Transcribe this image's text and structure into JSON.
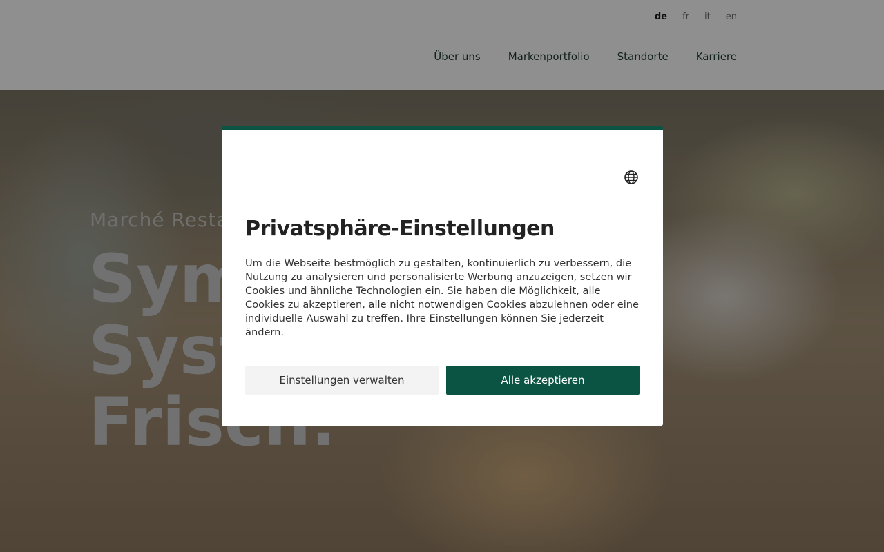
{
  "header": {
    "languages": [
      {
        "label": "de",
        "active": true
      },
      {
        "label": "fr",
        "active": false
      },
      {
        "label": "it",
        "active": false
      },
      {
        "label": "en",
        "active": false
      }
    ],
    "nav": [
      "Über uns",
      "Markenportfolio",
      "Standorte",
      "Karriere"
    ]
  },
  "hero": {
    "subtitle": "Marché Resta",
    "title_lines": [
      "Sym",
      "Syst",
      "Frisch."
    ]
  },
  "modal": {
    "language_icon": "globe-icon",
    "title": "Privatsphäre-Einstellungen",
    "text": "Um die Webseite bestmöglich zu gestalten, kontinuierlich zu verbessern, die Nutzung zu analysieren und personalisierte Werbung anzuzeigen, setzen wir Cookies und ähnliche Technologien ein. Sie haben die Möglichkeit, alle Cookies zu akzeptieren, alle nicht notwendigen Cookies abzulehnen oder eine individuelle Auswahl zu treffen. Ihre Einstellungen können Sie jederzeit ändern.",
    "manage_label": "Einstellungen verwalten",
    "accept_label": "Alle akzeptieren",
    "accent_color": "#0b5444"
  }
}
